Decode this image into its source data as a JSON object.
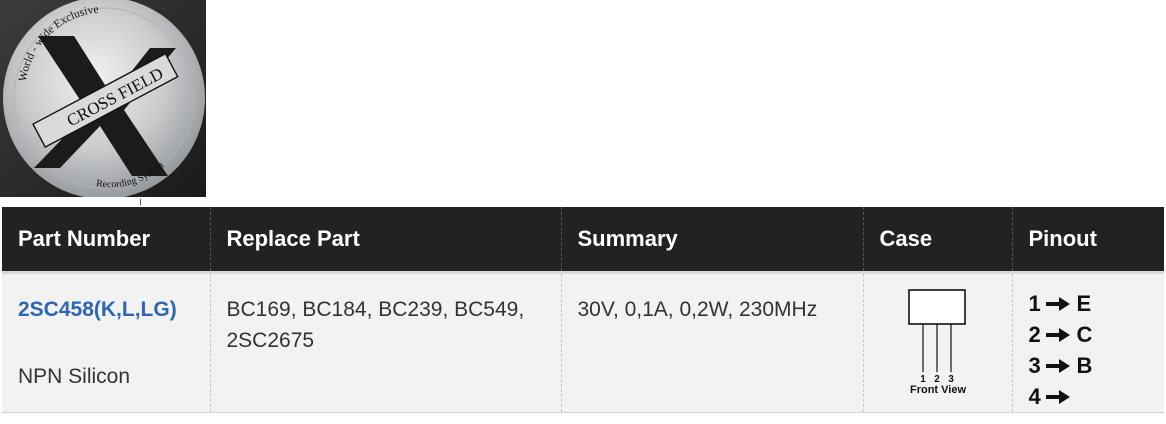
{
  "logo": {
    "top_text": "World - wide Exclusive",
    "brand_left": "CROSS",
    "brand_right": "FIELD",
    "bottom_text": "Recording System"
  },
  "table": {
    "headers": [
      "Part Number",
      "Replace Part",
      "Summary",
      "Case",
      "Pinout"
    ],
    "rows": [
      {
        "part_number": "2SC458(K,L,LG)",
        "part_type": "NPN Silicon",
        "replace_part": "BC169, BC184, BC239, BC549, 2SC2675",
        "summary": "30V, 0,1A, 0,2W, 230MHz",
        "case": {
          "pin_labels": [
            "1",
            "2",
            "3"
          ],
          "view_label": "Front View"
        },
        "pinout": [
          {
            "num": "1",
            "label": "E"
          },
          {
            "num": "2",
            "label": "C"
          },
          {
            "num": "3",
            "label": "B"
          },
          {
            "num": "4",
            "label": ""
          }
        ]
      }
    ]
  },
  "colors": {
    "header_bg": "#222222",
    "link": "#2d66b3",
    "row_bg": "#f2f2f2"
  }
}
